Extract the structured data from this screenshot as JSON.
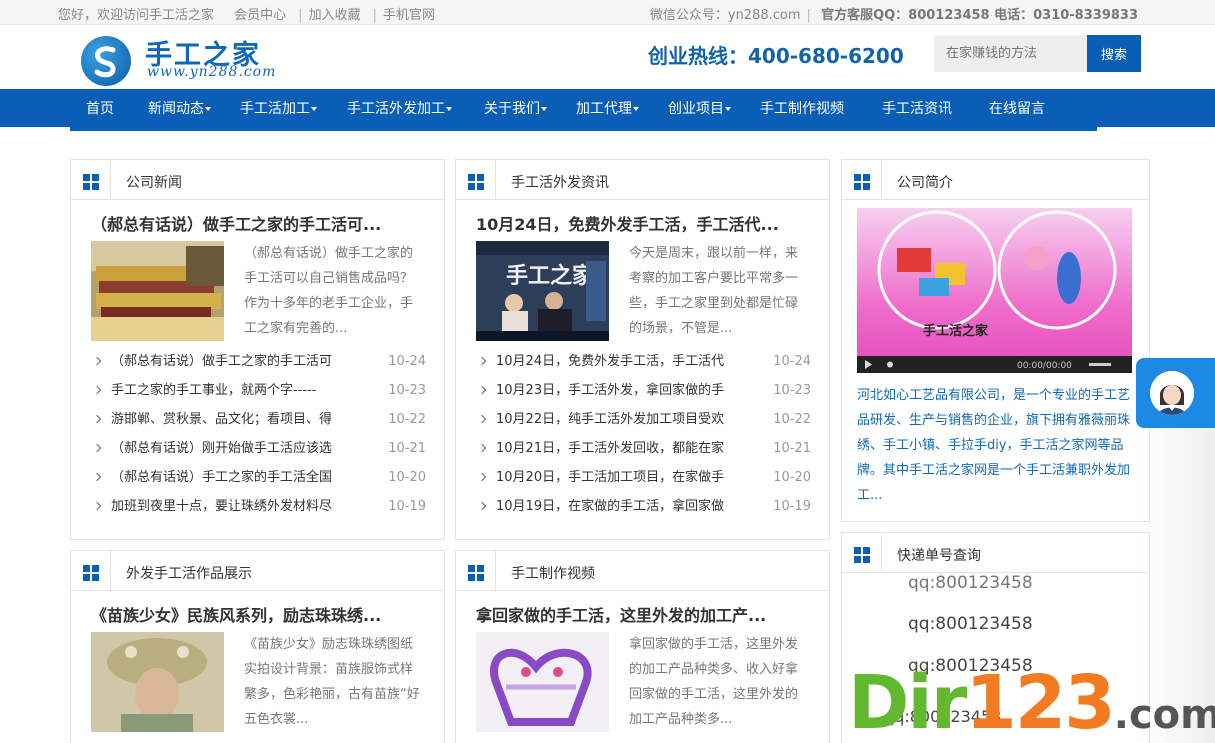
{
  "topbar": {
    "greeting": "您好，欢迎访问手工活之家",
    "member": "会员中心",
    "favorite": "加入收藏",
    "mobile": "手机官网",
    "wechat": "微信公众号：yn288.com",
    "service_label": "官方客服QQ：800123458 电话：0310-8339833"
  },
  "header": {
    "logo_title": "手工之家",
    "logo_url": "www.yn288.com",
    "hotline": "创业热线：400-680-6200",
    "search_placeholder": "在家赚钱的方法",
    "search_button": "搜索"
  },
  "nav": [
    {
      "label": "首页",
      "dropdown": false
    },
    {
      "label": "新闻动态",
      "dropdown": true
    },
    {
      "label": "手工活加工",
      "dropdown": true
    },
    {
      "label": "手工活外发加工",
      "dropdown": true
    },
    {
      "label": "关于我们",
      "dropdown": true
    },
    {
      "label": "加工代理",
      "dropdown": true
    },
    {
      "label": "创业项目",
      "dropdown": true
    },
    {
      "label": "手工制作视频",
      "dropdown": false
    },
    {
      "label": "手工活资讯",
      "dropdown": false
    },
    {
      "label": "在线留言",
      "dropdown": false
    }
  ],
  "company_news": {
    "title": "公司新闻",
    "feature_title": "（郝总有话说）做手工之家的手工活可...",
    "feature_desc": "（郝总有话说）做手工之家的手工活可以自己销售成品吗？作为十多年的老手工企业，手工之家有完善的...",
    "items": [
      {
        "t": "（郝总有话说）做手工之家的手工活可",
        "d": "10-24"
      },
      {
        "t": "手工之家的手工事业，就两个字-----",
        "d": "10-23"
      },
      {
        "t": "游邯郸、赏秋景、品文化；看项目、得",
        "d": "10-22"
      },
      {
        "t": "（郝总有话说）刚开始做手工活应该选",
        "d": "10-21"
      },
      {
        "t": "（郝总有话说）手工之家的手工活全国",
        "d": "10-20"
      },
      {
        "t": "加班到夜里十点，要让珠绣外发材料尽",
        "d": "10-19"
      }
    ]
  },
  "outsource_news": {
    "title": "手工活外发资讯",
    "feature_title": "10月24日，免费外发手工活，手工活代...",
    "feature_desc": "今天是周末，跟以前一样，来考察的加工客户要比平常多一些，手工之家里到处都是忙碌的场景，不管是...",
    "items": [
      {
        "t": "10月24日，免费外发手工活，手工活代",
        "d": "10-24"
      },
      {
        "t": "10月23日，手工活外发，拿回家做的手",
        "d": "10-23"
      },
      {
        "t": "10月22日，纯手工活外发加工项目受欢",
        "d": "10-22"
      },
      {
        "t": "10月21日，手工活外发回收，都能在家",
        "d": "10-21"
      },
      {
        "t": "10月20日，手工活加工项目，在家做手",
        "d": "10-20"
      },
      {
        "t": "10月19日，在家做的手工活，拿回家做",
        "d": "10-19"
      }
    ]
  },
  "intro": {
    "title": "公司简介",
    "video_caption": "手工活之家",
    "video_time": "00:00/00:00",
    "text": "河北如心工艺品有限公司，是一个专业的手工艺品研发、生产与销售的企业，旗下拥有雅薇丽珠绣、手工小镇、手拉手diy，手工活之家网等品牌。其中手工活之家网是一个手工活兼职外发加工..."
  },
  "works": {
    "title": "外发手工活作品展示",
    "feature_title": "《苗族少女》民族风系列，励志珠珠绣...",
    "feature_desc": "《苗族少女》励志珠珠绣图纸实拍设计背景：苗族服饰式样繁多，色彩艳丽，古有苗族“好五色衣裳..."
  },
  "videos": {
    "title": "手工制作视频",
    "feature_title": "拿回家做的手工活，这里外发的加工产...",
    "feature_desc": "拿回家做的手工活，这里外发的加工产品种类多、收入好拿回家做的手工活，这里外发的加工产品种类多..."
  },
  "express": {
    "title": "快递单号查询",
    "lines": [
      "qq:800123458",
      "qq:800123458",
      "qq:800123458",
      "qq:800123458"
    ]
  },
  "watermark": {
    "p1": "Dir",
    "p2": "123",
    "p3": ".com"
  },
  "colors": {
    "brand_blue": "#0b5eb6",
    "link_blue": "#1068b8",
    "service_blue": "#1e88e5"
  },
  "icons": {
    "panel": "grid-icon",
    "list": "chevron-right-icon",
    "service": "customer-service-avatar-icon"
  }
}
